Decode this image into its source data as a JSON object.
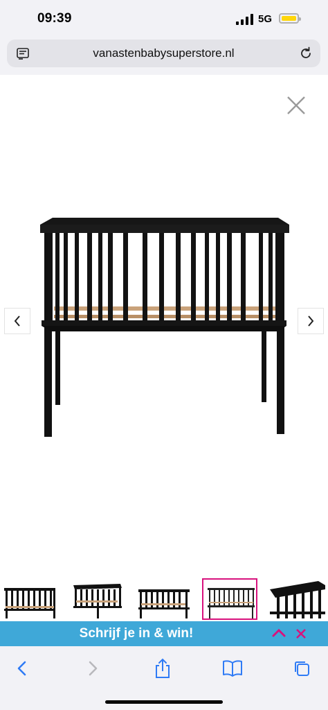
{
  "status_bar": {
    "time": "09:39",
    "network": "5G",
    "battery_color": "#ffd60a"
  },
  "address_bar": {
    "url": "vanastenbabysuperstore.nl",
    "reader_icon": "reader-mode-icon",
    "reload_icon": "reload-icon"
  },
  "viewer": {
    "close_icon": "close-icon",
    "prev_icon": "chevron-left-icon",
    "next_icon": "chevron-right-icon",
    "image_alt": "",
    "thumbnail_count": 5,
    "active_thumbnail": 4,
    "active_color": "#d8127d"
  },
  "banner": {
    "text": "Schrijf je in & win!",
    "background": "#3fa8d8",
    "accent": "#d8127d"
  },
  "toolbar": {
    "items": [
      "back-icon",
      "forward-icon",
      "share-icon",
      "bookmarks-icon",
      "tabs-icon"
    ],
    "tint": "#2f7bf5"
  }
}
